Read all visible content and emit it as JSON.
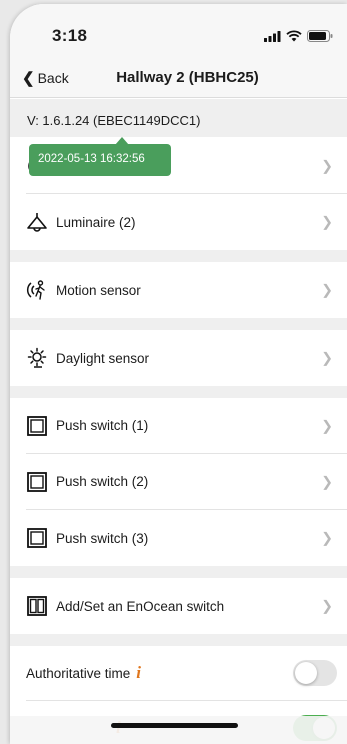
{
  "status_bar": {
    "time": "3:18"
  },
  "nav": {
    "back_label": "Back",
    "title": "Hallway 2 (HBHC25)"
  },
  "version": {
    "text": "V: 1.6.1.24  (EBEC1149DCC1)"
  },
  "tooltip": {
    "text": "2022-05-13 16:32:56"
  },
  "menu": [
    {
      "label": "",
      "icon": "clock-icon"
    },
    {
      "label": "Luminaire (2)",
      "icon": "lamp-icon"
    },
    {
      "label": "Motion sensor",
      "icon": "motion-sensor-icon"
    },
    {
      "label": "Daylight sensor",
      "icon": "sun-icon"
    },
    {
      "label": "Push switch (1)",
      "icon": "push-switch-icon"
    },
    {
      "label": "Push switch (2)",
      "icon": "push-switch-icon"
    },
    {
      "label": "Push switch (3)",
      "icon": "push-switch-icon"
    },
    {
      "label": "Add/Set an EnOcean switch",
      "icon": "enocean-switch-icon"
    }
  ],
  "settings": [
    {
      "label": "Authoritative time",
      "enabled": false
    },
    {
      "label": "",
      "enabled": true
    }
  ],
  "colors": {
    "tooltip_green": "#4a9e5c",
    "toggle_on": "#4caf50",
    "toggle_off": "#e4e4e4",
    "info_orange": "#e0761d"
  }
}
